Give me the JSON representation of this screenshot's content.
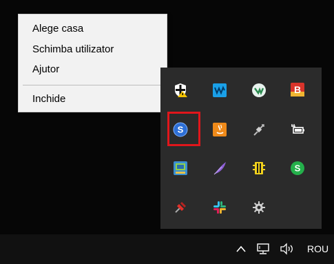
{
  "context_menu": {
    "items": [
      {
        "label": "Alege casa"
      },
      {
        "label": "Schimba utilizator"
      },
      {
        "label": "Ajutor"
      },
      {
        "label": "Inchide"
      }
    ]
  },
  "tray_flyout": {
    "icons": [
      {
        "name": "windows-security-warning-icon"
      },
      {
        "name": "waves-icon"
      },
      {
        "name": "veeam-icon"
      },
      {
        "name": "b-red-app-icon"
      },
      {
        "name": "s-blue-app-icon"
      },
      {
        "name": "orange-java-icon"
      },
      {
        "name": "network-plug-icon"
      },
      {
        "name": "power-battery-icon"
      },
      {
        "name": "blue-monitor-app-icon"
      },
      {
        "name": "purple-feather-icon"
      },
      {
        "name": "yellow-chip-icon"
      },
      {
        "name": "green-s-icon"
      },
      {
        "name": "red-pin-icon"
      },
      {
        "name": "slack-icon"
      },
      {
        "name": "gear-cog-icon"
      }
    ],
    "highlighted": "s-blue-app-icon",
    "highlight_color": "#e0161b"
  },
  "taskbar": {
    "language": "ROU"
  }
}
